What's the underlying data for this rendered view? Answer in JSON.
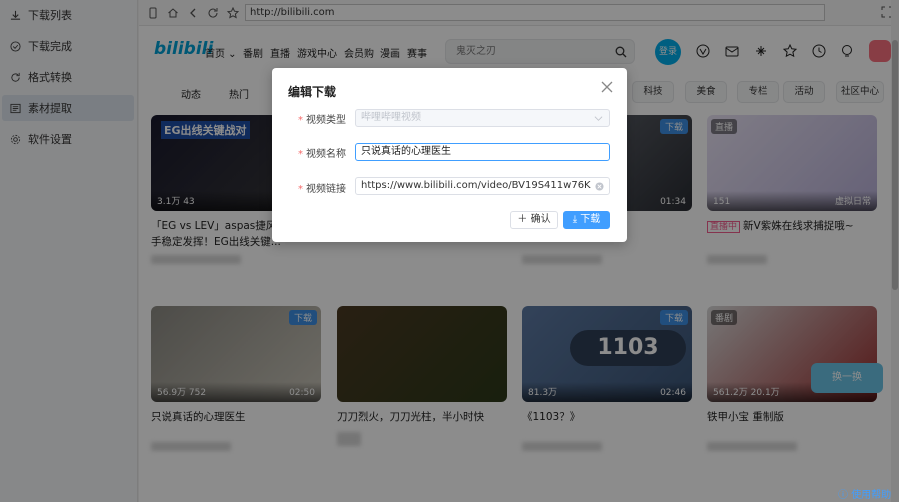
{
  "sidebar": {
    "items": [
      {
        "label": "下载列表",
        "icon": "download-icon"
      },
      {
        "label": "下载完成",
        "icon": "check-circle-icon"
      },
      {
        "label": "格式转换",
        "icon": "refresh-icon"
      },
      {
        "label": "素材提取",
        "icon": "extract-icon",
        "active": true
      },
      {
        "label": "软件设置",
        "icon": "gear-icon"
      }
    ]
  },
  "browser": {
    "url": "http://bilibili.com"
  },
  "site": {
    "logo": "bilibili",
    "menu": [
      "首页 ⌄",
      "番剧",
      "直播",
      "游戏中心",
      "会员购",
      "漫画",
      "赛事"
    ],
    "search_placeholder": "鬼灭之刃",
    "login": "登录",
    "chips_left": [
      "动态",
      "热门"
    ],
    "chips": [
      "科技",
      "美食",
      "专栏",
      "活动",
      "社区中心"
    ]
  },
  "cards": [
    {
      "title": "「EG vs LEV」aspas捷风狂秀，头手稳定发挥！EG出线关键...",
      "views": "3.1万",
      "likes": "43",
      "duration": "",
      "badge": "",
      "thumb_text": "EG出线关键战对"
    },
    {
      "title": "...",
      "views": "",
      "likes": "",
      "duration": "01:34",
      "badge": "下载",
      "thumb_text": ""
    },
    {
      "title": "新V紫姝在线求捕捉哦~",
      "views": "151",
      "likes": "",
      "duration": "虚拟日常",
      "badge": "直播",
      "thumb_text": "",
      "live": "直播中"
    },
    {
      "title": "只说真话的心理医生",
      "views": "56.9万",
      "likes": "752",
      "duration": "02:50",
      "badge": "下载"
    },
    {
      "title": "刀刀烈火，刀刀光柱，半小时快",
      "views": "",
      "likes": "",
      "duration": "",
      "badge": ""
    },
    {
      "title": "《1103？》",
      "views": "81.3万",
      "likes": "",
      "duration": "02:46",
      "badge": "下载",
      "thumb_text": "1103"
    },
    {
      "title": "铁甲小宝 重制版",
      "views": "561.2万",
      "likes": "20.1万",
      "duration": "",
      "badge": "番剧"
    }
  ],
  "modal": {
    "title": "编辑下载",
    "type_label": "视频类型",
    "type_value": "哔哩哔哩视频",
    "name_label": "视频名称",
    "name_value": "只说真话的心理医生",
    "link_label": "视频链接",
    "link_value": "https://www.bilibili.com/video/BV19S411w76K",
    "confirm": "确认",
    "download": "下载"
  },
  "help": "使用帮助",
  "refresh_btn": "换一换"
}
